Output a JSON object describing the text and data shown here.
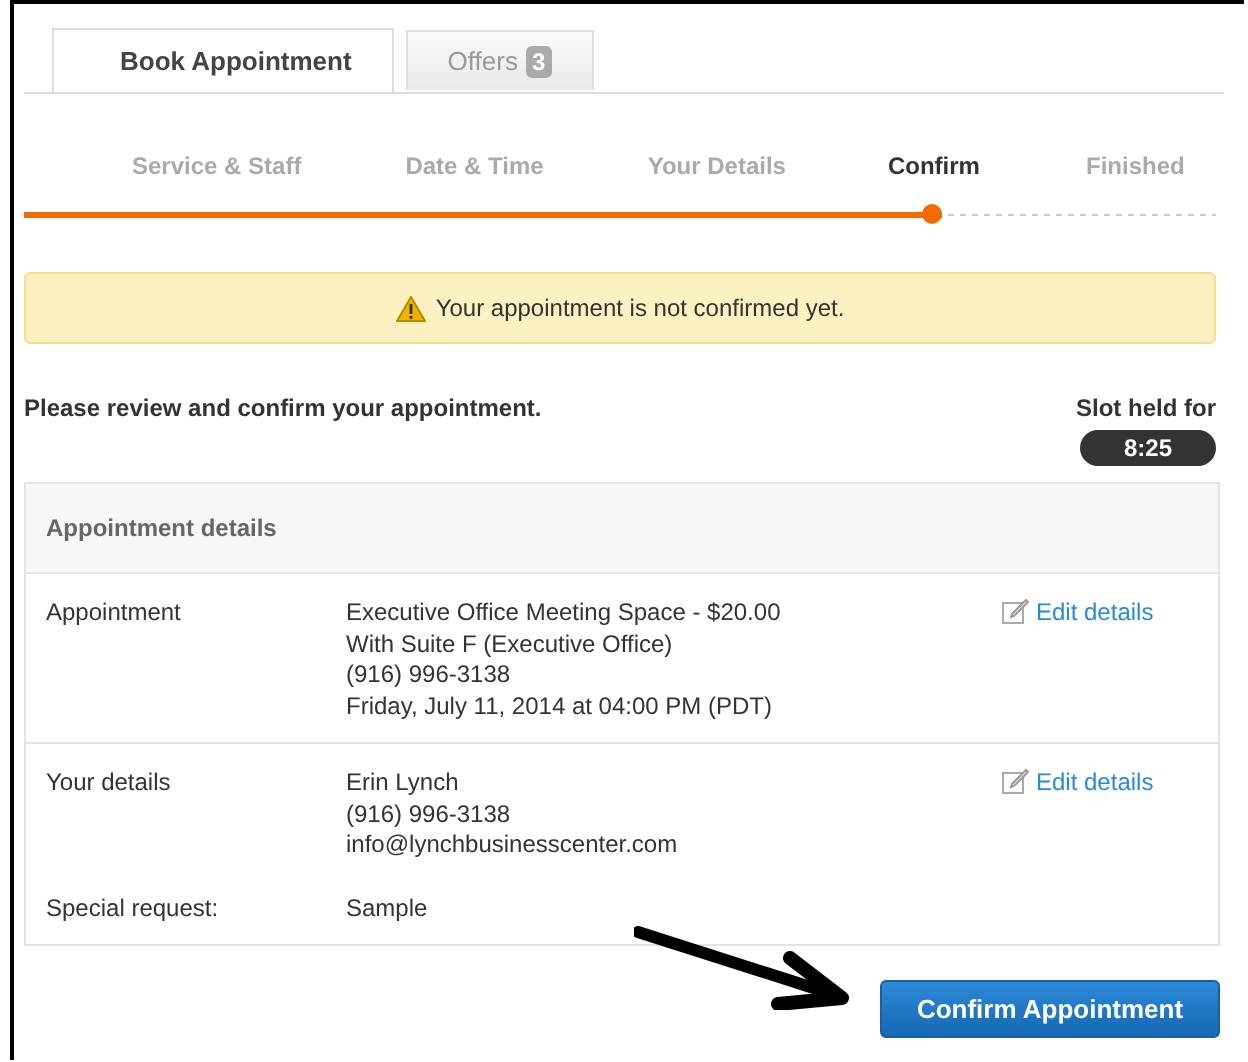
{
  "tabs": [
    {
      "label": "Book Appointment",
      "selected": true
    },
    {
      "label": "Offers",
      "badge": "3",
      "selected": false
    }
  ],
  "steps": [
    {
      "label": "Service & Staff",
      "selected": false
    },
    {
      "label": "Date & Time",
      "selected": false
    },
    {
      "label": "Your Details",
      "selected": false
    },
    {
      "label": "Confirm",
      "selected": true
    },
    {
      "label": "Finished",
      "selected": false
    }
  ],
  "progress": {
    "level": 0.77
  },
  "alert": {
    "text": "Your appointment is not confirmed yet."
  },
  "intro": "Please review and confirm your appointment.",
  "slot": {
    "label": "Slot held for",
    "time": "8:25"
  },
  "details": {
    "title": "Appointment details",
    "sections": [
      {
        "rows": [
          {
            "label": "Appointment",
            "lines": [
              "Executive Office Meeting Space - $20.00",
              "With Suite F (Executive Office)",
              "(916) 996-3138",
              "Friday, July 11, 2014 at 04:00 PM (PDT)"
            ],
            "link": "Edit details"
          }
        ]
      },
      {
        "rows": [
          {
            "label": "Your details",
            "lines": [
              "Erin Lynch",
              "(916) 996-3138",
              "info@lynchbusinesscenter.com"
            ],
            "link": "Edit details"
          },
          {
            "label": "Special request:",
            "lines": [
              "Sample"
            ]
          }
        ]
      }
    ]
  },
  "confirm_button": "Confirm Appointment"
}
